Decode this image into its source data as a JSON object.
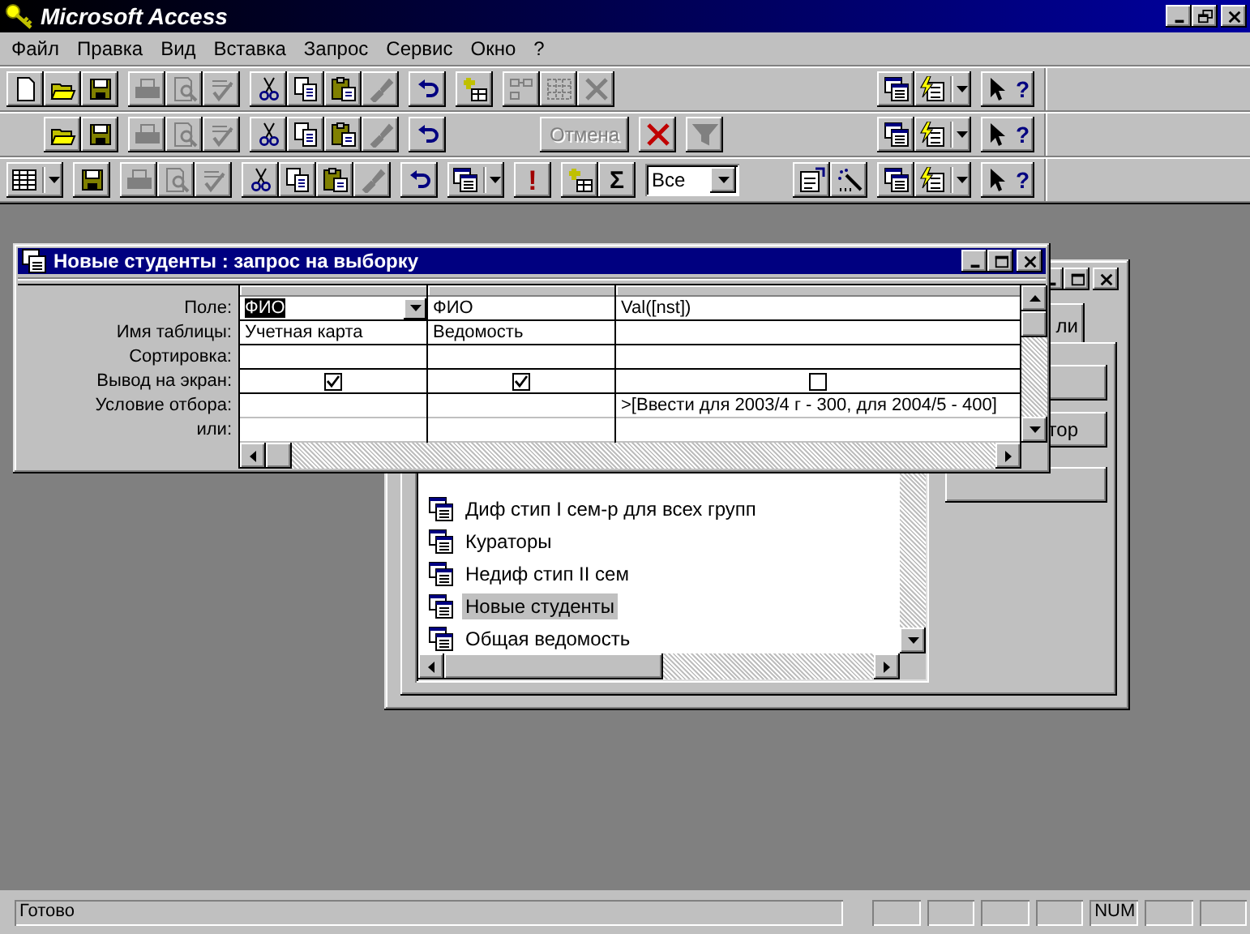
{
  "app": {
    "title": "Microsoft Access"
  },
  "menu": [
    {
      "label": "Файл"
    },
    {
      "label": "Правка"
    },
    {
      "label": "Вид"
    },
    {
      "label": "Вставка"
    },
    {
      "label": "Запрос"
    },
    {
      "label": "Сервис"
    },
    {
      "label": "Окно"
    },
    {
      "label": "?"
    }
  ],
  "toolbars": [
    {
      "left": [
        [
          {
            "kind": "new",
            "disabled": false
          },
          {
            "kind": "open",
            "disabled": false
          },
          {
            "kind": "save",
            "disabled": false
          }
        ],
        [
          {
            "kind": "print",
            "disabled": true
          },
          {
            "kind": "preview",
            "disabled": true
          },
          {
            "kind": "spell",
            "disabled": true
          }
        ],
        [
          {
            "kind": "cut",
            "disabled": false
          },
          {
            "kind": "copy",
            "disabled": false
          },
          {
            "kind": "paste",
            "disabled": false
          },
          {
            "kind": "painter",
            "disabled": true
          }
        ],
        [
          {
            "kind": "undo",
            "disabled": false
          }
        ],
        [
          {
            "kind": "newobj",
            "disabled": false
          }
        ],
        [
          {
            "kind": "boxes",
            "disabled": true
          },
          {
            "kind": "grid",
            "disabled": true
          },
          {
            "kind": "delete",
            "disabled": true
          }
        ]
      ],
      "right": [
        [
          {
            "kind": "dbwin",
            "disabled": false
          },
          {
            "kind": "autoform",
            "disabled": false,
            "dropdown": true
          }
        ],
        [
          {
            "kind": "help",
            "disabled": false,
            "label": "?"
          }
        ]
      ]
    },
    {
      "left": [
        [
          {
            "kind": "gap"
          },
          {
            "kind": "open",
            "disabled": false
          },
          {
            "kind": "save",
            "disabled": false
          }
        ],
        [
          {
            "kind": "print",
            "disabled": true
          },
          {
            "kind": "preview",
            "disabled": true
          },
          {
            "kind": "spell",
            "disabled": true
          }
        ],
        [
          {
            "kind": "cut",
            "disabled": false
          },
          {
            "kind": "copy",
            "disabled": false
          },
          {
            "kind": "paste",
            "disabled": false
          },
          {
            "kind": "painter",
            "disabled": true
          }
        ],
        [
          {
            "kind": "undo",
            "disabled": false
          }
        ],
        [
          {
            "kind": "gap"
          },
          {
            "kind": "gap"
          }
        ],
        [
          {
            "kind": "text",
            "label": "Отмена",
            "disabled": true
          }
        ],
        [
          {
            "kind": "delete",
            "disabled": false
          }
        ],
        [
          {
            "kind": "filter",
            "disabled": true
          }
        ]
      ],
      "right": [
        [
          {
            "kind": "dbwin",
            "disabled": false
          },
          {
            "kind": "autoform",
            "disabled": false,
            "dropdown": true
          }
        ],
        [
          {
            "kind": "help",
            "disabled": false,
            "label": "?"
          }
        ]
      ]
    },
    {
      "left": [
        [
          {
            "kind": "view",
            "disabled": false,
            "dropdown": true
          }
        ],
        [
          {
            "kind": "save",
            "disabled": false
          }
        ],
        [
          {
            "kind": "print",
            "disabled": true
          },
          {
            "kind": "preview",
            "disabled": true
          },
          {
            "kind": "spell",
            "disabled": true
          }
        ],
        [
          {
            "kind": "cut",
            "disabled": false
          },
          {
            "kind": "copy",
            "disabled": false
          },
          {
            "kind": "paste",
            "disabled": false
          },
          {
            "kind": "painter",
            "disabled": true
          }
        ],
        [
          {
            "kind": "undo",
            "disabled": false
          }
        ],
        [
          {
            "kind": "querytype",
            "disabled": false,
            "dropdown": true
          }
        ],
        [
          {
            "kind": "run",
            "disabled": false,
            "label": "!"
          }
        ],
        [
          {
            "kind": "newobj",
            "disabled": false
          },
          {
            "kind": "totals",
            "disabled": false,
            "label": "Σ"
          }
        ],
        [
          {
            "kind": "combo",
            "value": "Все"
          }
        ]
      ],
      "right": [
        [
          {
            "kind": "props",
            "disabled": false
          },
          {
            "kind": "builder",
            "disabled": false
          }
        ],
        [
          {
            "kind": "dbwin",
            "disabled": false
          },
          {
            "kind": "autoform",
            "disabled": false,
            "dropdown": true
          }
        ],
        [
          {
            "kind": "help",
            "disabled": false,
            "label": "?"
          }
        ]
      ]
    }
  ],
  "query_window": {
    "title": "Новые студенты : запрос на выборку",
    "row_labels": [
      "Поле:",
      "Имя таблицы:",
      "Сортировка:",
      "Вывод на экран:",
      "Условие отбора:",
      "или:"
    ],
    "columns": [
      {
        "field": "ФИО",
        "table": "Учетная карта",
        "show": true,
        "focused": true
      },
      {
        "field": "ФИО",
        "table": "Ведомость",
        "show": true,
        "focused": false
      },
      {
        "field": "Val([nst])",
        "show": false,
        "criteria": ">[Ввести для 2003/4 г -  300, для 2004/5 - 400]",
        "focused": false
      }
    ]
  },
  "database_window": {
    "tab": {
      "label": "ли"
    },
    "buttons": [
      {
        "kind": "blank"
      },
      {
        "kind": "label",
        "label": "тор"
      },
      {
        "kind": "blank"
      }
    ],
    "items": [
      {
        "label": "Диф стип I сем-р для всех групп",
        "selected": false
      },
      {
        "label": "Кураторы",
        "selected": false
      },
      {
        "label": "Недиф стип II сем",
        "selected": false
      },
      {
        "label": "Новые студенты",
        "selected": true
      },
      {
        "label": "Общая ведомость",
        "selected": false
      }
    ]
  },
  "status_bar": {
    "text": "Готово",
    "panels": [
      {
        "kind": "blank"
      },
      {
        "kind": "blank"
      },
      {
        "kind": "blank"
      },
      {
        "kind": "blank"
      },
      {
        "kind": "label",
        "label": "NUM"
      },
      {
        "kind": "blank"
      },
      {
        "kind": "blank"
      }
    ]
  }
}
